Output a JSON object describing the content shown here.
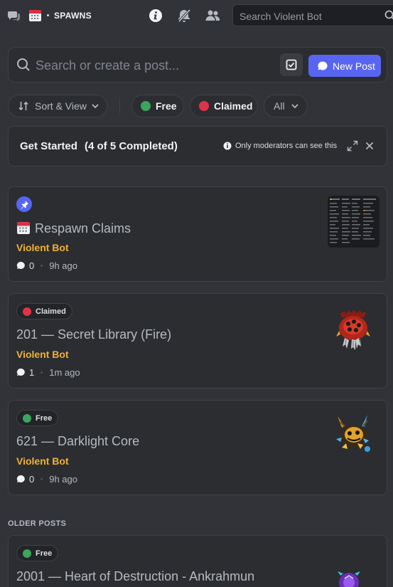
{
  "header": {
    "channel_icon": "forum-icon",
    "channel_emoji": "calendar-emoji",
    "channel_name": "SPAWNS",
    "icons": [
      "info-icon",
      "bell-slash-icon",
      "members-icon",
      "search-icon"
    ],
    "search_placeholder": "Search Violent Bot"
  },
  "post_search": {
    "placeholder": "Search or create a post...",
    "tag_button_icon": "tag-filter-icon",
    "new_post_label": "New Post"
  },
  "filters": {
    "sort_label": "Sort & View",
    "tags": [
      {
        "label": "Free",
        "color": "#3ba55c"
      },
      {
        "label": "Claimed",
        "color": "#e0334a"
      }
    ],
    "all_label": "All"
  },
  "get_started": {
    "title": "Get Started",
    "progress": "(4 of 5 Completed)",
    "moderator_note": "Only moderators can see this"
  },
  "posts": [
    {
      "pinned": true,
      "title": "Respawn Claims",
      "title_emoji": "calendar-emoji",
      "author": "Violent Bot",
      "replies": "0",
      "time": "9h ago",
      "thumbnail": "screenshot-thumbnail"
    },
    {
      "tag": "Claimed",
      "tag_color": "#e0334a",
      "title": "201 — Secret Library (Fire)",
      "author": "Violent Bot",
      "replies": "1",
      "time": "1m ago",
      "thumbnail": "fire-creature-sprite"
    },
    {
      "tag": "Free",
      "tag_color": "#3ba55c",
      "title": "621 — Darklight Core",
      "author": "Violent Bot",
      "replies": "0",
      "time": "9h ago",
      "thumbnail": "darklight-creature-sprite"
    }
  ],
  "older_posts_label": "OLDER POSTS",
  "older_posts": [
    {
      "tag": "Free",
      "tag_color": "#3ba55c",
      "title": "2001 — Heart of Destruction - Ankrahmun",
      "thumbnail": "purple-creature-sprite"
    }
  ],
  "colors": {
    "background": "#313338",
    "card": "#2b2d31",
    "accent": "#5865f2",
    "author": "#f0b232"
  }
}
